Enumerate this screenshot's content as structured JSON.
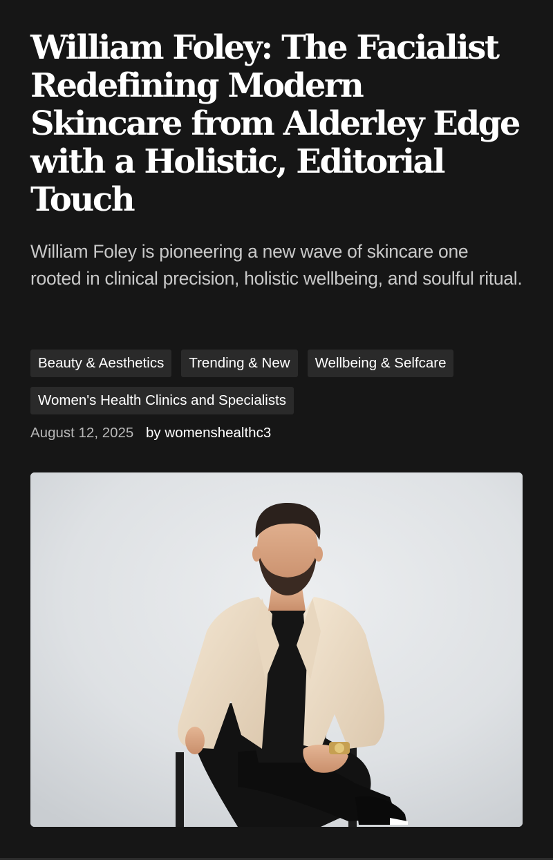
{
  "article": {
    "title": "William Foley: The Facialist Redefining Modern Skincare from Alderley Edge with a Holistic, Editorial Touch",
    "subtitle": "William Foley is pioneering a new wave of skincare one rooted in clinical precision, holistic wellbeing, and soulful ritual.",
    "tags": [
      "Beauty & Aesthetics",
      "Trending & New",
      "Wellbeing & Selfcare",
      "Women's Health Clinics and Specialists"
    ],
    "date": "August 12, 2025",
    "by_label": "by",
    "author": "womenshealthc3"
  },
  "colors": {
    "background": "#161616",
    "tag_background": "#2a2a2a",
    "subtitle_text": "#c8c8c8",
    "meta_text": "#b8b8b8"
  }
}
